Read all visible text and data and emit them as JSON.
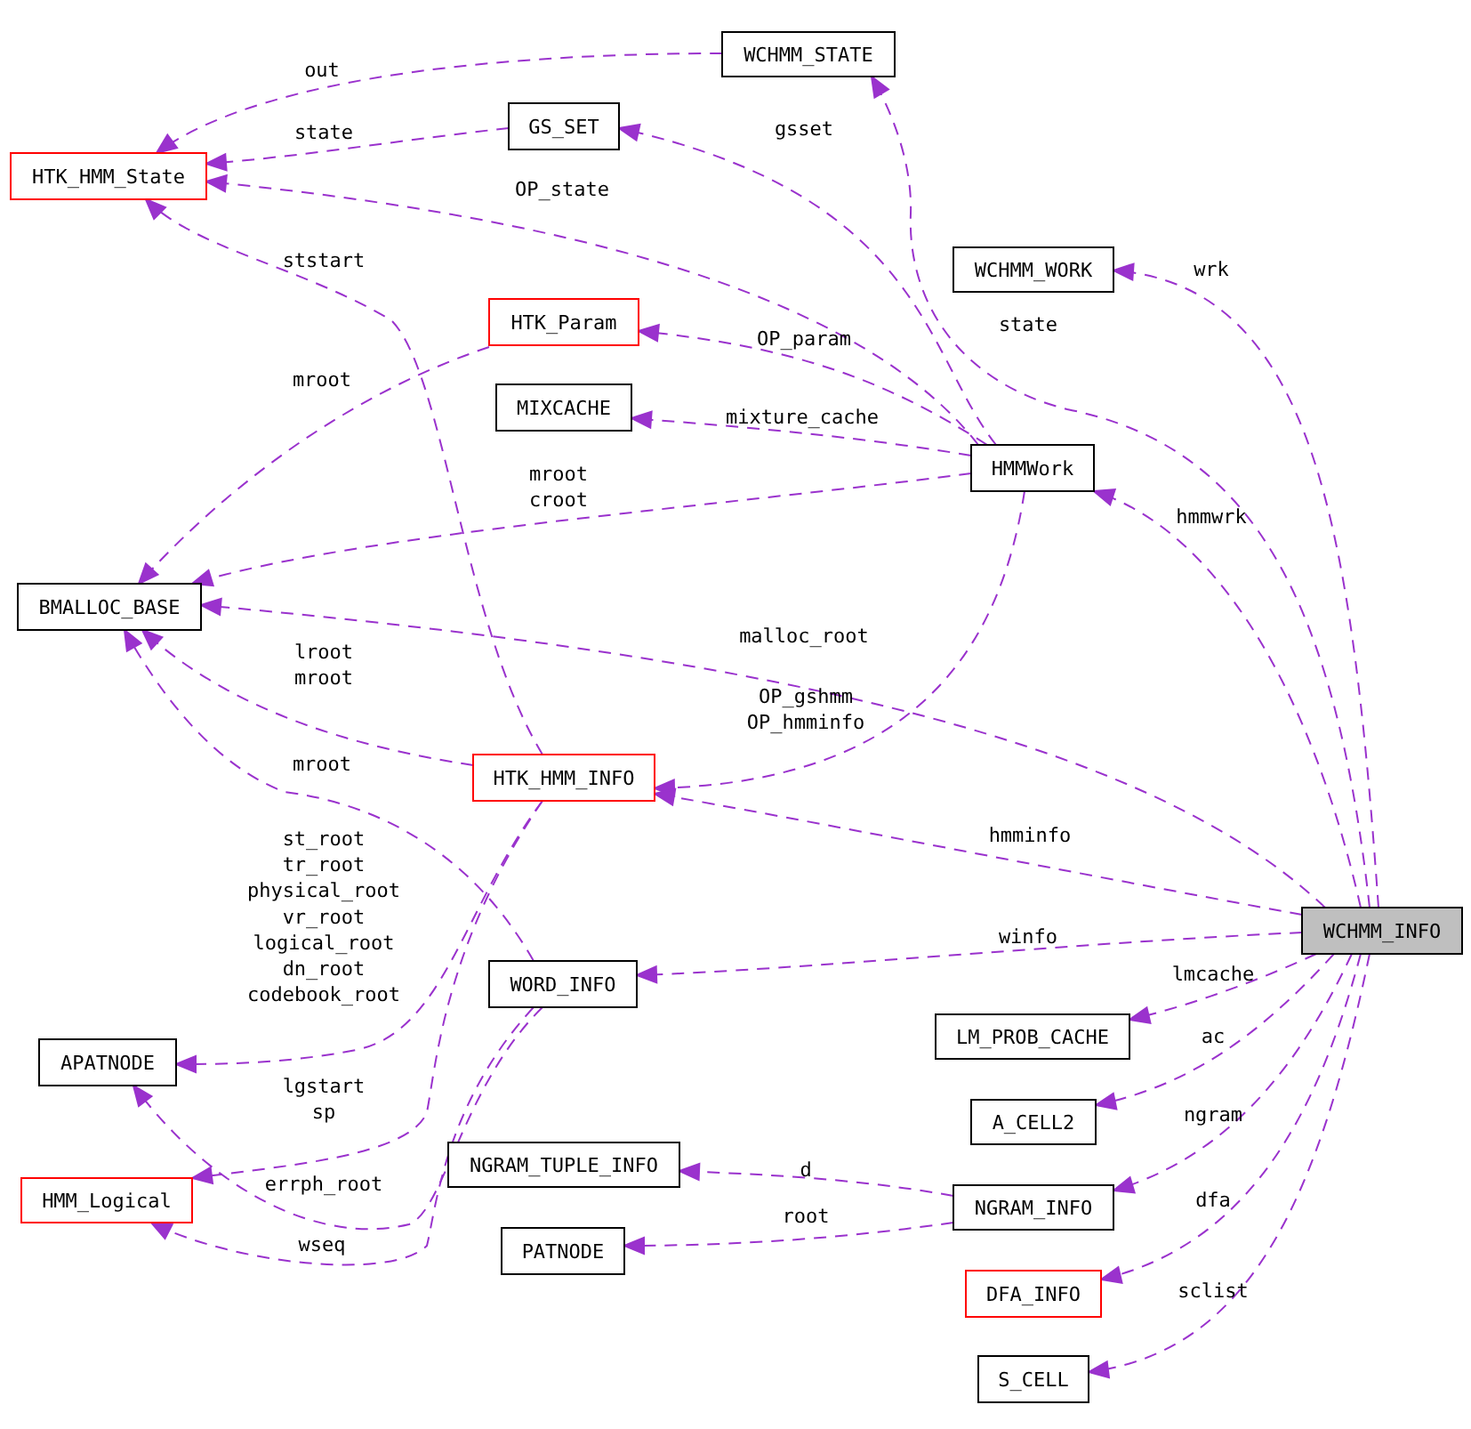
{
  "diagram": {
    "nodes": [
      {
        "name": "WCHMM_STATE",
        "kind": "class"
      },
      {
        "name": "GS_SET",
        "kind": "class"
      },
      {
        "name": "HTK_HMM_State",
        "kind": "truncated"
      },
      {
        "name": "WCHMM_WORK",
        "kind": "class"
      },
      {
        "name": "HTK_Param",
        "kind": "truncated"
      },
      {
        "name": "MIXCACHE",
        "kind": "class"
      },
      {
        "name": "HMMWork",
        "kind": "class"
      },
      {
        "name": "BMALLOC_BASE",
        "kind": "class"
      },
      {
        "name": "HTK_HMM_INFO",
        "kind": "truncated"
      },
      {
        "name": "WCHMM_INFO",
        "kind": "main"
      },
      {
        "name": "WORD_INFO",
        "kind": "class"
      },
      {
        "name": "LM_PROB_CACHE",
        "kind": "class"
      },
      {
        "name": "APATNODE",
        "kind": "class"
      },
      {
        "name": "A_CELL2",
        "kind": "class"
      },
      {
        "name": "NGRAM_TUPLE_INFO",
        "kind": "class"
      },
      {
        "name": "HMM_Logical",
        "kind": "truncated"
      },
      {
        "name": "NGRAM_INFO",
        "kind": "class"
      },
      {
        "name": "PATNODE",
        "kind": "class"
      },
      {
        "name": "DFA_INFO",
        "kind": "truncated"
      },
      {
        "name": "S_CELL",
        "kind": "class"
      }
    ],
    "edges": [
      {
        "labels": [
          "out"
        ]
      },
      {
        "labels": [
          "state"
        ]
      },
      {
        "labels": [
          "OP_state"
        ]
      },
      {
        "labels": [
          "gsset"
        ]
      },
      {
        "labels": [
          "state"
        ]
      },
      {
        "labels": [
          "ststart"
        ]
      },
      {
        "labels": [
          "wrk"
        ]
      },
      {
        "labels": [
          "OP_param"
        ]
      },
      {
        "labels": [
          "mixture_cache"
        ]
      },
      {
        "labels": [
          "hmmwrk"
        ]
      },
      {
        "labels": [
          "mroot"
        ]
      },
      {
        "labels": [
          "mroot",
          "croot"
        ]
      },
      {
        "labels": [
          "malloc_root"
        ]
      },
      {
        "labels": [
          "lroot",
          "mroot"
        ]
      },
      {
        "labels": [
          "mroot"
        ]
      },
      {
        "labels": [
          "OP_gshmm",
          "OP_hmminfo"
        ]
      },
      {
        "labels": [
          "hmminfo"
        ]
      },
      {
        "labels": [
          "winfo"
        ]
      },
      {
        "labels": [
          "st_root",
          "tr_root",
          "physical_root",
          "vr_root",
          "logical_root",
          "dn_root",
          "codebook_root"
        ]
      },
      {
        "labels": [
          "lmcache"
        ]
      },
      {
        "labels": [
          "ac"
        ]
      },
      {
        "labels": [
          "lgstart",
          "sp"
        ]
      },
      {
        "labels": [
          "errph_root"
        ]
      },
      {
        "labels": [
          "wseq"
        ]
      },
      {
        "labels": [
          "ngram"
        ]
      },
      {
        "labels": [
          "d"
        ]
      },
      {
        "labels": [
          "root"
        ]
      },
      {
        "labels": [
          "dfa"
        ]
      },
      {
        "labels": [
          "sclist"
        ]
      }
    ]
  }
}
